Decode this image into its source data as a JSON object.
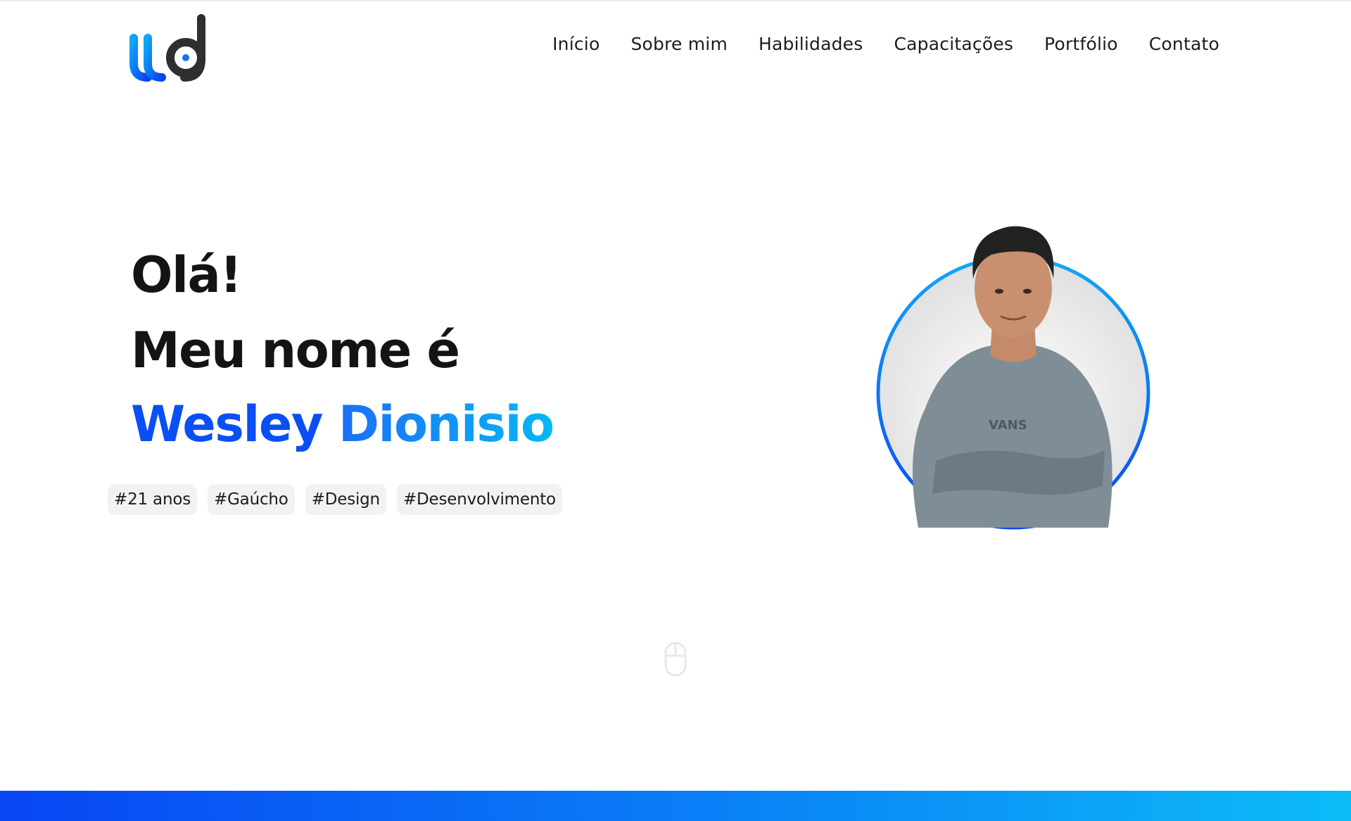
{
  "brand": {
    "logo_icon": "wd-logo-icon",
    "colors": {
      "blue": "#0a4ff3",
      "cyan": "#08b6f6",
      "dark": "#2f2f2f"
    }
  },
  "nav": {
    "items": [
      {
        "label": "Início"
      },
      {
        "label": "Sobre mim"
      },
      {
        "label": "Habilidades"
      },
      {
        "label": "Capacitações"
      },
      {
        "label": "Portfólio"
      },
      {
        "label": "Contato"
      }
    ]
  },
  "hero": {
    "greeting": "Olá!",
    "intro": "Meu nome é",
    "first_name": "Wesley",
    "last_name": "Dionisio",
    "tags": [
      "#21 anos",
      "#Gaúcho",
      "#Design",
      "#Desenvolvimento"
    ],
    "portrait_icon": "profile-photo",
    "scroll_icon": "mouse-scroll-icon"
  },
  "footer": {
    "accent": [
      "#0846f4",
      "#0cbcf7"
    ]
  }
}
